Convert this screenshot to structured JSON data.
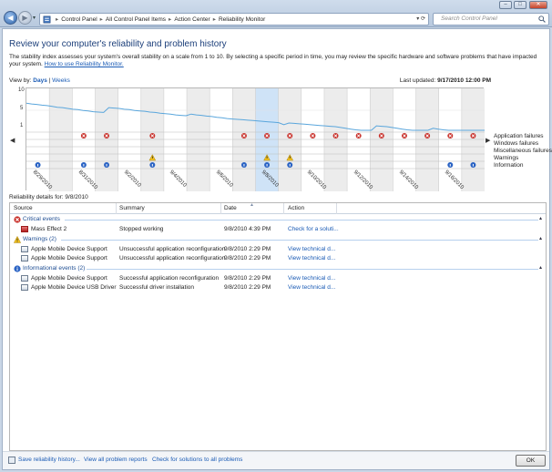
{
  "window": {
    "minimize": "–",
    "maximize": "□",
    "close": "✕"
  },
  "nav": {
    "back_icon": "arrow-left-icon",
    "forward_icon": "arrow-right-icon",
    "drop": "▾"
  },
  "breadcrumb": {
    "items": [
      "Control Panel",
      "All Control Panel Items",
      "Action Center",
      "Reliability Monitor"
    ],
    "separator": "▸",
    "arrows": "▾ ⟳"
  },
  "search": {
    "placeholder": "Search Control Panel"
  },
  "page": {
    "title": "Review your computer's reliability and problem history",
    "description": "The stability index assesses your system's overall stability on a scale from 1 to 10. By selecting a specific period in time, you may review the specific hardware and software problems that have impacted your system.",
    "description_link": "How to use Reliability Monitor.",
    "view_by_label": "View by:",
    "view_days": "Days",
    "view_sep": "|",
    "view_weeks": "Weeks",
    "last_updated_label": "Last updated:",
    "last_updated_value": "9/17/2010 12:00 PM",
    "details_for": "Reliability details for: 9/8/2010"
  },
  "chart_data": {
    "type": "line",
    "y_ticks": [
      "10",
      "5",
      "1"
    ],
    "ylim": [
      1,
      10
    ],
    "series": [
      {
        "values": [
          6.8,
          6.6,
          6.5,
          6.3,
          6.2,
          6.0,
          5.8,
          5.7,
          5.5,
          5.3,
          5.2,
          5.0,
          4.9,
          4.7,
          4.6,
          4.5,
          5.7,
          5.6,
          5.5,
          5.3,
          5.2,
          5.0,
          4.9,
          4.8,
          4.6,
          4.5,
          4.3,
          4.2,
          4.1,
          3.9,
          3.8,
          3.7,
          4.1,
          3.9,
          3.8,
          3.6,
          3.5,
          3.3,
          3.2,
          3.0,
          2.9,
          2.8,
          2.7,
          2.6,
          2.5,
          2.4,
          2.3,
          2.2,
          2.1,
          2.0,
          1.5,
          1.9,
          1.8,
          1.7,
          1.6,
          1.5,
          1.4,
          1.3,
          1.2,
          1.1,
          1.0,
          0.9,
          0.8,
          0.7,
          0.6,
          0.5,
          0.4,
          0.3,
          1.2,
          1.1,
          1.0,
          0.9,
          0.8,
          0.7,
          0.6,
          0.5,
          0.4,
          0.3,
          0.2,
          0.8,
          0.7,
          0.6,
          0.5,
          0.4,
          0.3,
          0.2,
          0.1,
          0.1,
          0.5,
          0.4
        ]
      }
    ],
    "row_labels": [
      "Application failures",
      "Windows failures",
      "Miscellaneous failures",
      "Warnings",
      "Information"
    ],
    "dates": [
      "8/29/2010",
      "8/31/2010",
      "9/2/2010",
      "9/4/2010",
      "9/6/2010",
      "9/8/2010",
      "9/10/2010",
      "9/12/2010",
      "9/14/2010",
      "9/16/2010"
    ],
    "columns": 20,
    "selected_column": 10,
    "app_failure_columns": [
      2,
      3,
      5,
      9,
      10,
      11,
      12,
      13,
      14,
      15,
      16,
      17,
      18,
      19
    ],
    "warning_columns": [
      5,
      10,
      11
    ],
    "information_columns": [
      0,
      2,
      3,
      5,
      9,
      10,
      11,
      18,
      19
    ],
    "grid": true
  },
  "table": {
    "columns": [
      "Source",
      "Summary",
      "Date",
      "Action"
    ],
    "groups": [
      {
        "label": "Critical events",
        "icon": "error-icon",
        "rows": [
          {
            "source": "Mass Effect 2",
            "summary": "Stopped working",
            "date": "9/8/2010 4:39 PM",
            "action": "Check for a soluti..."
          }
        ]
      },
      {
        "label": "Warnings (2)",
        "icon": "warning-icon",
        "rows": [
          {
            "source": "Apple Mobile Device Support",
            "summary": "Unsuccessful application reconfiguration",
            "date": "9/8/2010 2:29 PM",
            "action": "View  technical d..."
          },
          {
            "source": "Apple Mobile Device Support",
            "summary": "Unsuccessful application reconfiguration",
            "date": "9/8/2010 2:29 PM",
            "action": "View  technical d..."
          }
        ]
      },
      {
        "label": "Informational events (2)",
        "icon": "info-icon",
        "rows": [
          {
            "source": "Apple Mobile Device Support",
            "summary": "Successful application reconfiguration",
            "date": "9/8/2010 2:29 PM",
            "action": "View  technical d..."
          },
          {
            "source": "Apple Mobile Device USB Driver",
            "summary": "Successful driver installation",
            "date": "9/8/2010 2:29 PM",
            "action": "View  technical d..."
          }
        ]
      }
    ],
    "collapse": "▴"
  },
  "footer": {
    "save": "Save reliability history...",
    "view_all": "View all problem reports",
    "check": "Check for solutions to all problems",
    "ok": "OK"
  }
}
